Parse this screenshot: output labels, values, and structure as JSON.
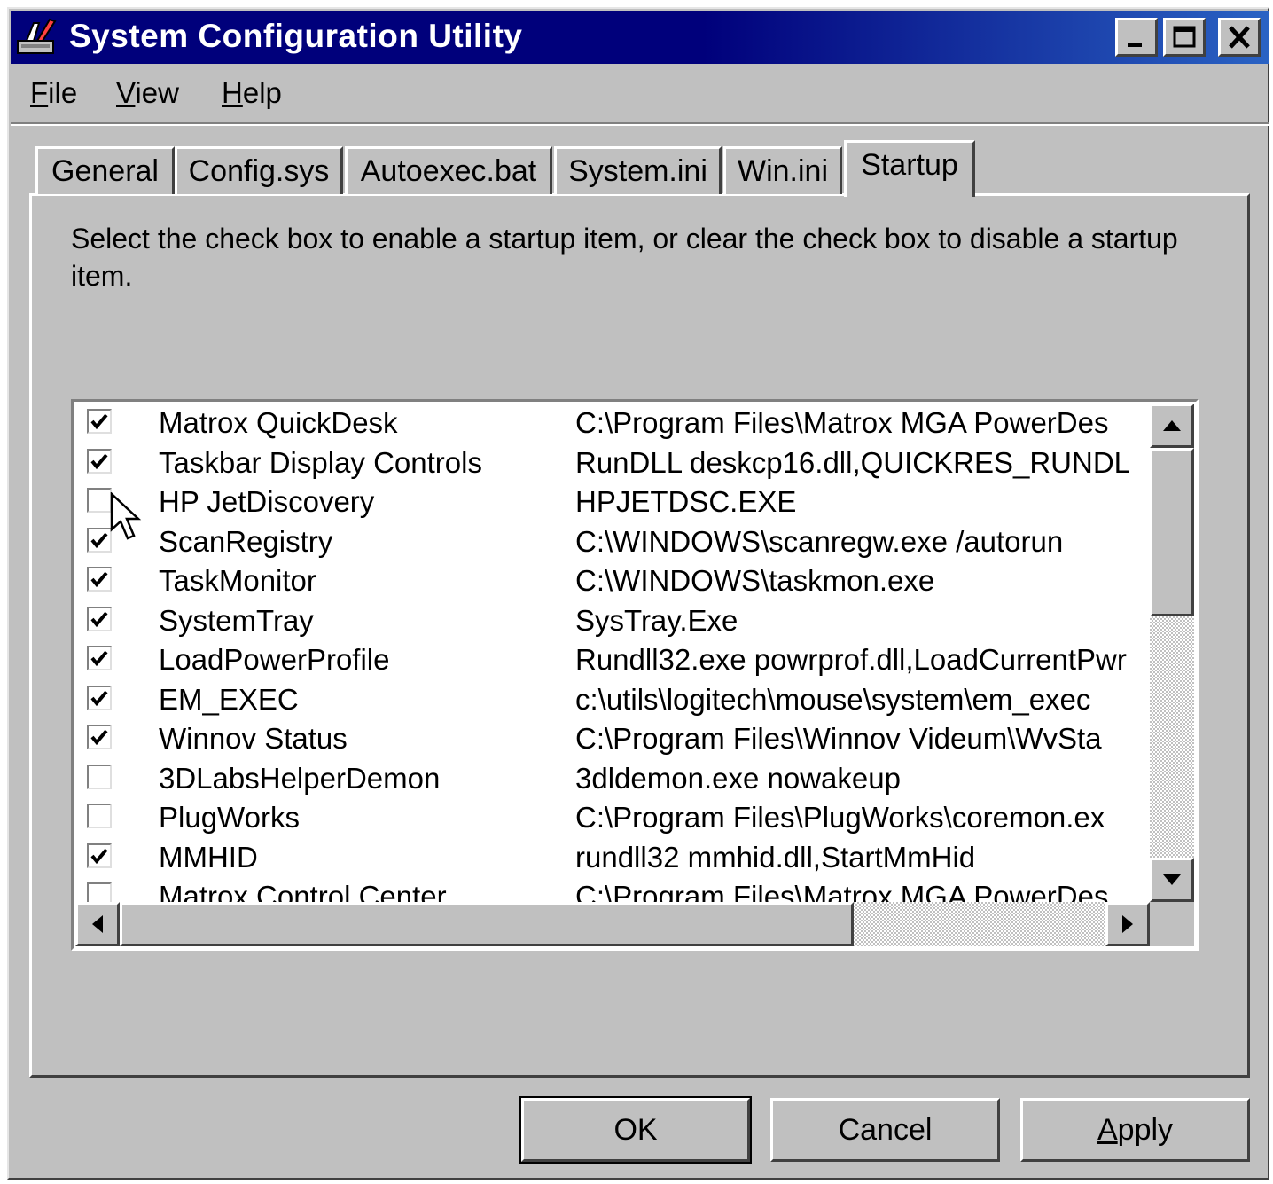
{
  "window": {
    "title": "System Configuration Utility",
    "title_bar_color": "#00007b"
  },
  "caption_buttons": [
    "minimize-icon",
    "maximize-icon",
    "close-icon"
  ],
  "menu": {
    "items": [
      {
        "hotkey": "F",
        "rest": "ile"
      },
      {
        "hotkey": "V",
        "rest": "iew"
      },
      {
        "hotkey": "H",
        "rest": "elp"
      }
    ]
  },
  "tabs": [
    {
      "label": "General"
    },
    {
      "label": "Config.sys"
    },
    {
      "label": "Autoexec.bat"
    },
    {
      "label": "System.ini"
    },
    {
      "label": "Win.ini"
    },
    {
      "label": "Startup",
      "active": true
    }
  ],
  "startup": {
    "instructions": "Select the check box to enable a startup item, or clear the check box to disable a startup item.",
    "items": [
      {
        "checked": true,
        "name": "Matrox QuickDesk",
        "command": "C:\\Program Files\\Matrox MGA PowerDes"
      },
      {
        "checked": true,
        "name": "Taskbar Display Controls",
        "command": "RunDLL deskcp16.dll,QUICKRES_RUNDL"
      },
      {
        "checked": false,
        "name": "HP JetDiscovery",
        "command": "HPJETDSC.EXE"
      },
      {
        "checked": true,
        "name": "ScanRegistry",
        "command": "C:\\WINDOWS\\scanregw.exe /autorun"
      },
      {
        "checked": true,
        "name": "TaskMonitor",
        "command": "C:\\WINDOWS\\taskmon.exe"
      },
      {
        "checked": true,
        "name": "SystemTray",
        "command": "SysTray.Exe"
      },
      {
        "checked": true,
        "name": "LoadPowerProfile",
        "command": "Rundll32.exe powrprof.dll,LoadCurrentPwr"
      },
      {
        "checked": true,
        "name": "EM_EXEC",
        "command": "c:\\utils\\logitech\\mouse\\system\\em_exec"
      },
      {
        "checked": true,
        "name": "Winnov Status",
        "command": "C:\\Program Files\\Winnov Videum\\WvSta"
      },
      {
        "checked": false,
        "name": "3DLabsHelperDemon",
        "command": "3dldemon.exe nowakeup"
      },
      {
        "checked": false,
        "name": "PlugWorks",
        "command": "C:\\Program Files\\PlugWorks\\coremon.ex"
      },
      {
        "checked": true,
        "name": "MMHID",
        "command": "rundll32 mmhid.dll,StartMmHid"
      },
      {
        "checked": false,
        "name": "Matrox Control Center",
        "command": "C:\\Program Files\\Matrox MGA PowerDes"
      }
    ]
  },
  "buttons": {
    "ok": "OK",
    "cancel": "Cancel",
    "apply_hotkey": "A",
    "apply_rest": "pply"
  }
}
